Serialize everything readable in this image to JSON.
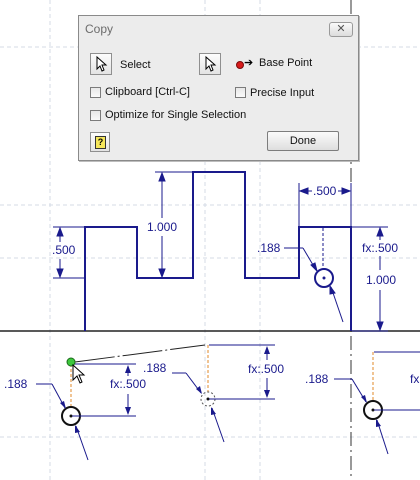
{
  "dialog": {
    "title": "Copy",
    "close_icon": "close-x-icon",
    "select_label": "Select",
    "base_point_label": "Base Point",
    "clipboard_label": "Clipboard [Ctrl-C]",
    "precise_input_label": "Precise Input",
    "optimize_label": "Optimize for Single Selection",
    "help_label": "?",
    "done_label": "Done",
    "clipboard_checked": false,
    "precise_input_checked": false,
    "optimize_checked": false
  },
  "sketch": {
    "dimensions": {
      "d_1000_mid": "1.000",
      "d_500_top_right": ".500",
      "d_500_left": ".500",
      "d_188_upper": ".188",
      "d_fx500_right": "fx:.500",
      "d_1000_right": "1.000",
      "d_188_lower_left": ".188",
      "d_fx500_lower_left": "fx:.500",
      "d_188_lower_mid": ".188",
      "d_fx500_lower_mid": "fx:.500",
      "d_188_lower_right": ".188",
      "d_fx_clipped": "fx"
    },
    "line_color": "#1a1a8c",
    "grid_color": "#d4dbe6"
  },
  "cursor_icon": "arrow-cursor-icon"
}
